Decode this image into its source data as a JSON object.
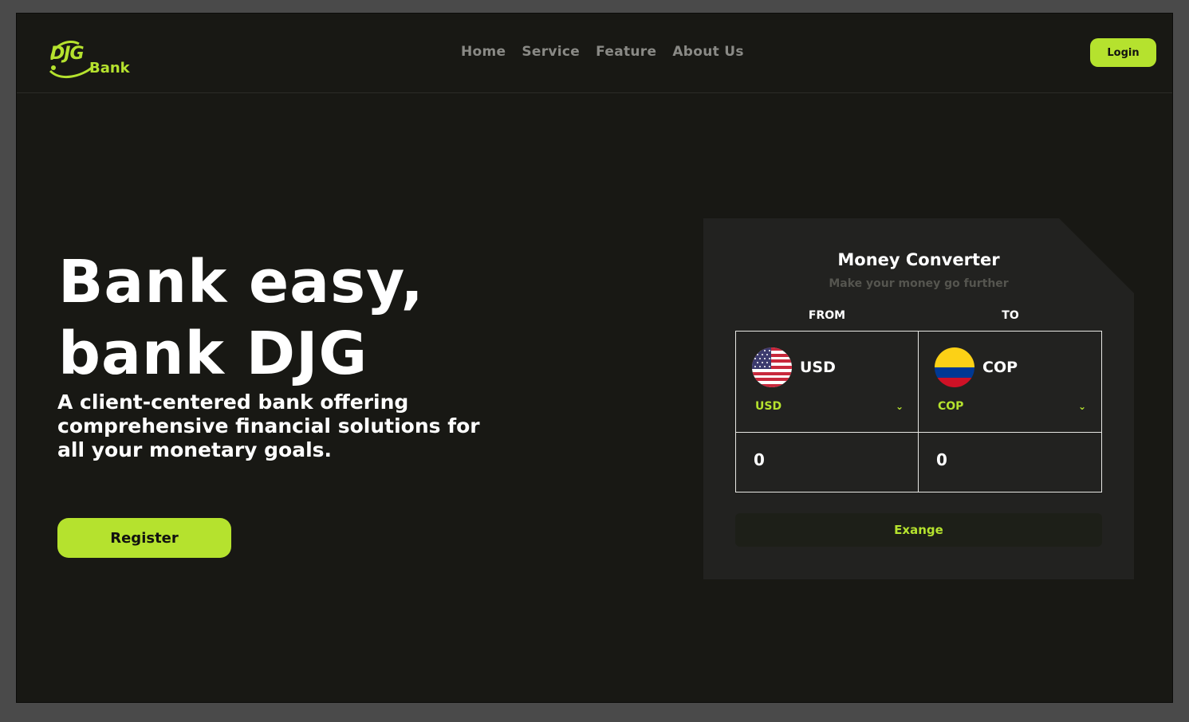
{
  "brand": {
    "logo_text": "DJG",
    "logo_suffix": "Bank"
  },
  "nav": {
    "items": [
      "Home",
      "Service",
      "Feature",
      "About Us"
    ],
    "login_label": "Login"
  },
  "hero": {
    "title_line1": "Bank easy,",
    "title_line2": "bank DJG",
    "subtitle": "A client-centered bank offering comprehensive financial solutions for all your monetary goals.",
    "register_label": "Register"
  },
  "converter": {
    "title": "Money Converter",
    "subtitle": "Make your money go further",
    "from_label": "FROM",
    "to_label": "TO",
    "from": {
      "code": "USD",
      "selected": "USD",
      "amount": "0",
      "flag_icon": "us-flag-icon"
    },
    "to": {
      "code": "COP",
      "selected": "COP",
      "amount": "0",
      "flag_icon": "colombia-flag-icon"
    },
    "exchange_label": "Exange"
  },
  "colors": {
    "accent": "#b5e22e",
    "background": "#181814",
    "card": "#222220",
    "nav_text": "#8a8a86"
  }
}
